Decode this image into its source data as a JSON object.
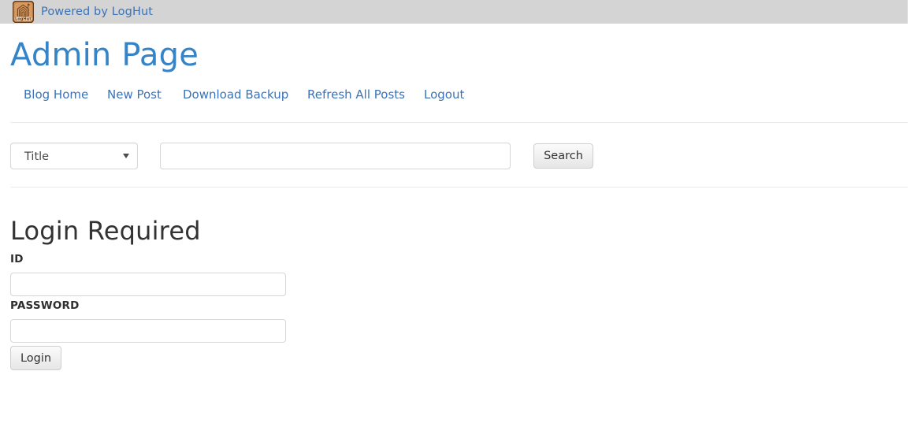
{
  "topbar": {
    "logo_alt": "LogHut",
    "logo_text": "LogHut",
    "powered_by": "Powered by LogHut",
    "background_color": "#d4d4d4",
    "link_color": "#3b73b9"
  },
  "header": {
    "title": "Admin Page",
    "title_color": "#3584c8"
  },
  "nav": {
    "items": [
      {
        "label": "Blog Home"
      },
      {
        "label": "New Post"
      },
      {
        "label": "Download Backup"
      },
      {
        "label": "Refresh All Posts"
      },
      {
        "label": "Logout"
      }
    ]
  },
  "search": {
    "field_select": {
      "selected": "Title",
      "options": [
        "Title"
      ]
    },
    "query": "",
    "placeholder": "",
    "button_label": "Search"
  },
  "login": {
    "heading": "Login Required",
    "id_label": "ID",
    "id_value": "",
    "id_placeholder": "",
    "password_label": "PASSWORD",
    "password_value": "",
    "password_placeholder": "",
    "submit_label": "Login"
  }
}
